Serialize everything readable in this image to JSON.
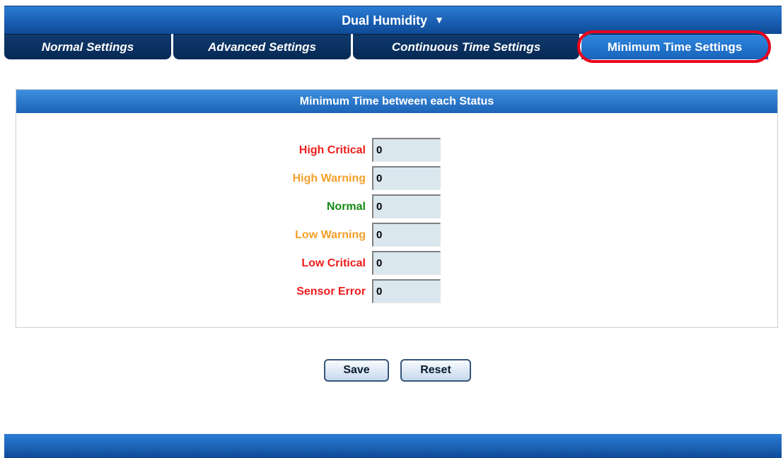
{
  "header": {
    "title": "Dual Humidity",
    "dropdown_icon": "triangle-down",
    "caret_glyph": "▼"
  },
  "tabs": [
    {
      "label": "Normal Settings",
      "active": false
    },
    {
      "label": "Advanced Settings",
      "active": false
    },
    {
      "label": "Continuous Time Settings",
      "active": false
    },
    {
      "label": "Minimum Time Settings",
      "active": true
    }
  ],
  "panel": {
    "title": "Minimum Time between each Status",
    "rows": [
      {
        "label": "High Critical",
        "value": "0",
        "color": "#ee1c1c"
      },
      {
        "label": "High Warning",
        "value": "0",
        "color": "#f3a02a"
      },
      {
        "label": "Normal",
        "value": "0",
        "color": "#138a13"
      },
      {
        "label": "Low Warning",
        "value": "0",
        "color": "#f3a02a"
      },
      {
        "label": "Low Critical",
        "value": "0",
        "color": "#ee1c1c"
      },
      {
        "label": "Sensor Error",
        "value": "0",
        "color": "#ee1c1c"
      }
    ]
  },
  "buttons": {
    "save_label": "Save",
    "reset_label": "Reset"
  },
  "colors": {
    "bar_blue": "#1a5fb2",
    "tab_dark": "#0b2f5c",
    "highlight": "#e8001c"
  }
}
